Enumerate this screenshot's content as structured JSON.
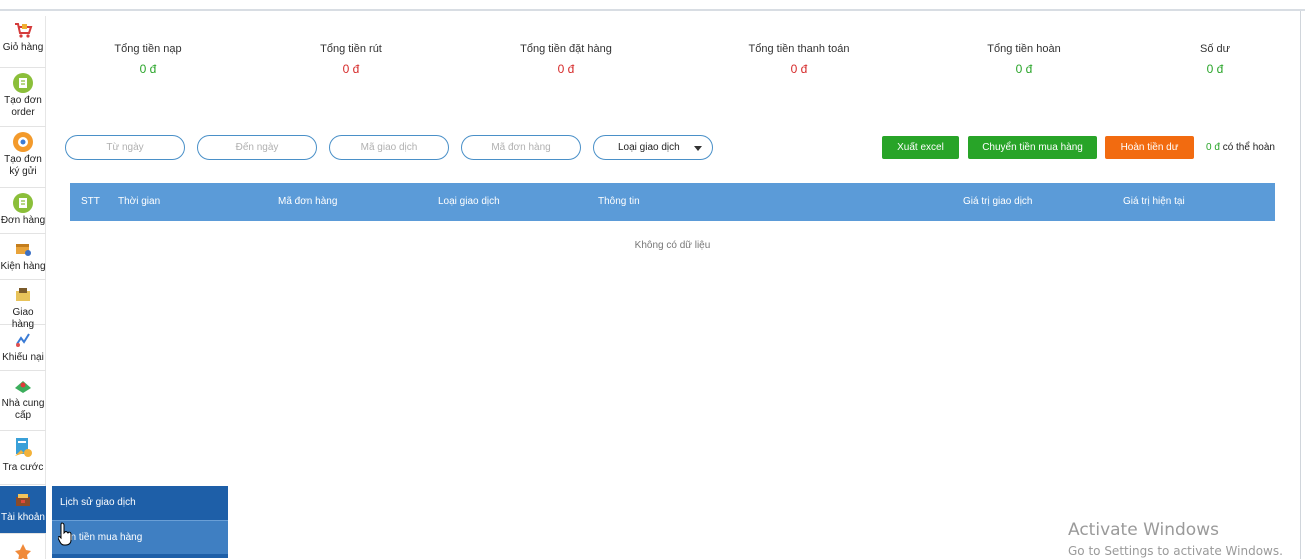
{
  "sidebar": {
    "items": [
      {
        "label": "Giỏ hàng",
        "icon": "cart-icon"
      },
      {
        "label": "Tạo đơn order",
        "icon": "create-order-icon"
      },
      {
        "label": "Tạo đơn ký gửi",
        "icon": "consignment-icon"
      },
      {
        "label": "Đơn hàng",
        "icon": "orders-icon"
      },
      {
        "label": "Kiện hàng",
        "icon": "package-icon"
      },
      {
        "label": "Giao hàng",
        "icon": "delivery-icon"
      },
      {
        "label": "Khiếu nại",
        "icon": "complaint-icon"
      },
      {
        "label": "Nhà cung cấp",
        "icon": "supplier-icon"
      },
      {
        "label": "Tra cước",
        "icon": "fee-lookup-icon"
      },
      {
        "label": "Tài khoản",
        "icon": "account-icon"
      }
    ]
  },
  "stats": [
    {
      "title": "Tổng tiền nạp",
      "value": "0 đ"
    },
    {
      "title": "Tổng tiền rút",
      "value": "0 đ"
    },
    {
      "title": "Tổng tiền đặt hàng",
      "value": "0 đ"
    },
    {
      "title": "Tổng tiền thanh toán",
      "value": "0 đ"
    },
    {
      "title": "Tổng tiền hoàn",
      "value": "0 đ"
    },
    {
      "title": "Số dư",
      "value": "0 đ"
    }
  ],
  "filters": {
    "from_date": "Từ ngày",
    "to_date": "Đến ngày",
    "transaction_code": "Mã giao dịch",
    "order_code": "Mã đơn hàng",
    "transaction_type": "Loại giao dịch"
  },
  "actions": {
    "export": "Xuất excel",
    "transfer": "Chuyển tiền mua hàng",
    "refund": "Hoàn tiền dư",
    "refund_amount": "0 đ",
    "refund_note": "có thể hoàn"
  },
  "table": {
    "columns": [
      "STT",
      "Thời gian",
      "Mã đơn hàng",
      "Loại giao dịch",
      "Thông tin",
      "Giá trị giao dịch",
      "Giá trị hiện tại"
    ],
    "empty": "Không có dữ liệu"
  },
  "submenu": {
    "items": [
      "Lịch sử giao dịch",
      "yển tiền mua hàng"
    ]
  },
  "watermark": {
    "line1": "Activate Windows",
    "line2": "Go to Settings to activate Windows."
  },
  "colors": {
    "primary": "#1e5fa8",
    "header": "#5b9bd8",
    "green": "#28a428",
    "orange": "#f26b10",
    "negative": "#d62a2a"
  }
}
